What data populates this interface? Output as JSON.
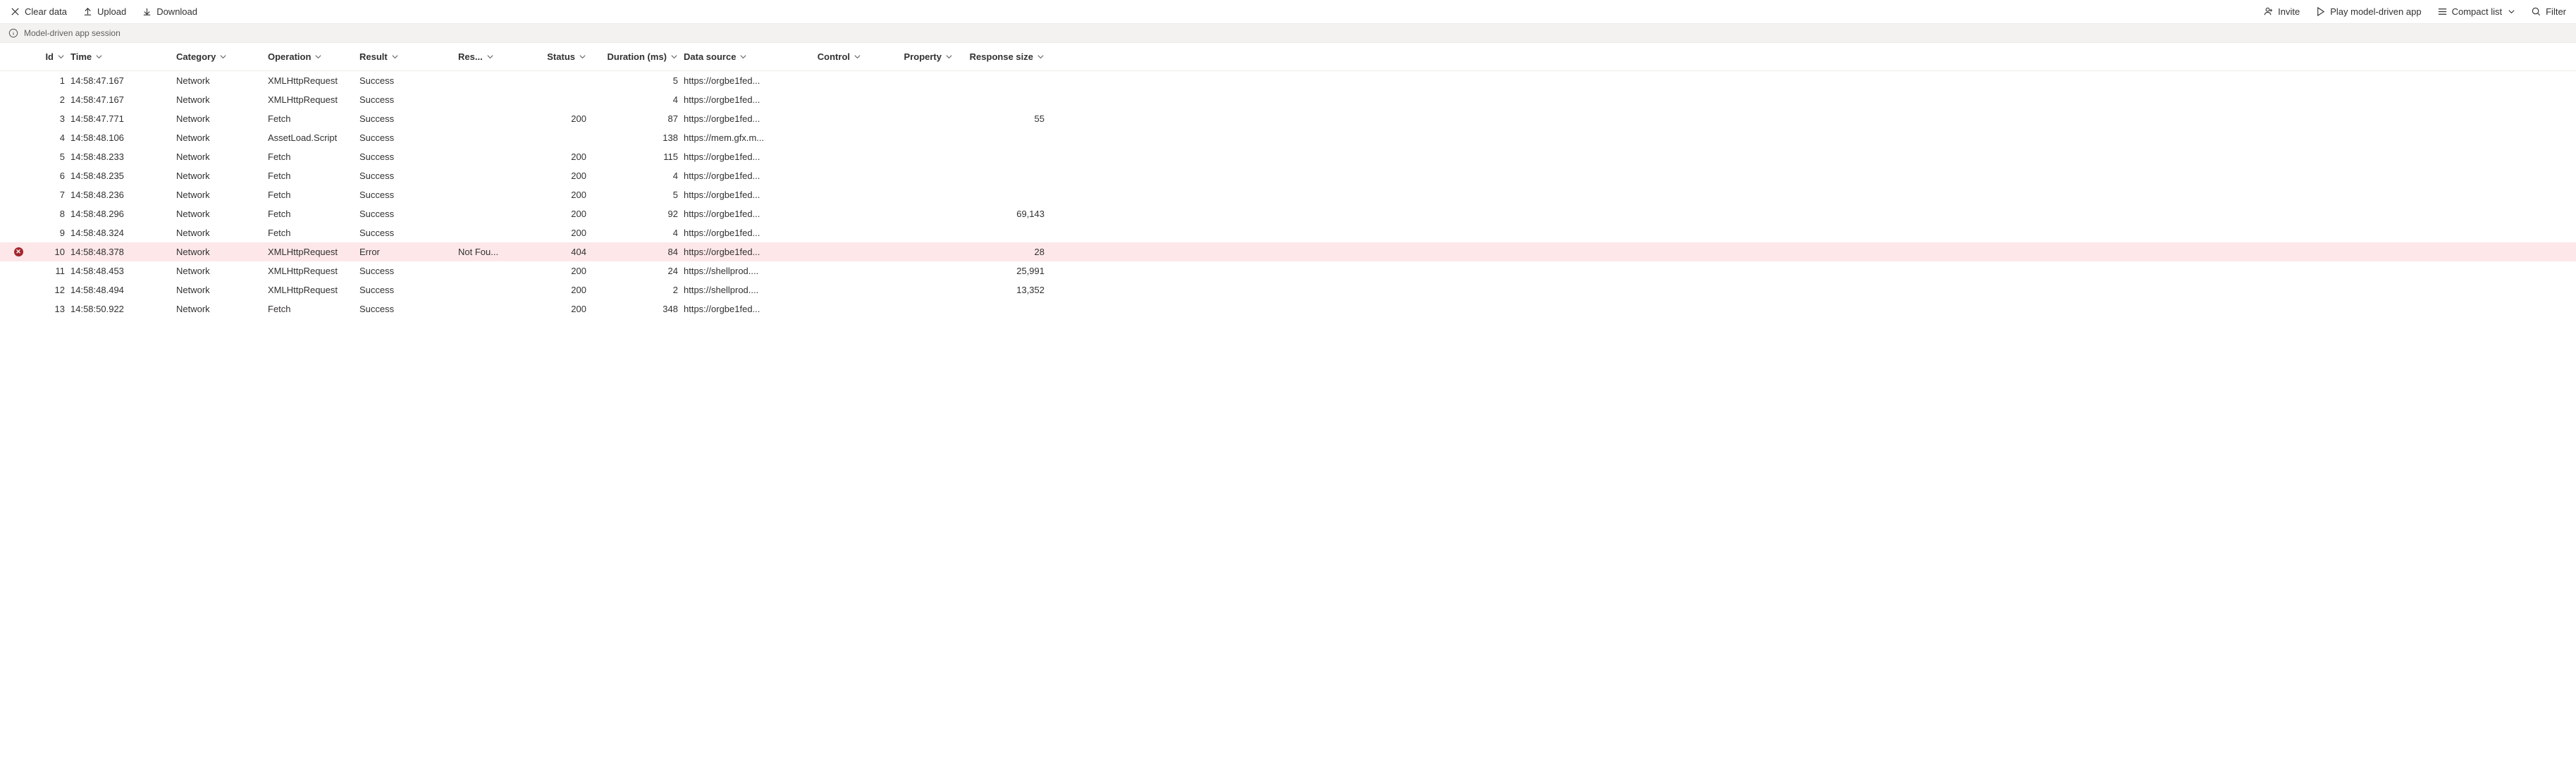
{
  "toolbar": {
    "clear_data": "Clear data",
    "upload": "Upload",
    "download": "Download",
    "invite": "Invite",
    "play_app": "Play model-driven app",
    "compact_list": "Compact list",
    "filter": "Filter"
  },
  "session_bar": {
    "label": "Model-driven app session"
  },
  "columns": {
    "id": "Id",
    "time": "Time",
    "category": "Category",
    "operation": "Operation",
    "result": "Result",
    "result_info": "Res...",
    "status": "Status",
    "duration": "Duration (ms)",
    "data_source": "Data source",
    "control": "Control",
    "property": "Property",
    "response_size": "Response size"
  },
  "rows": [
    {
      "id": "1",
      "time": "14:58:47.167",
      "category": "Network",
      "operation": "XMLHttpRequest",
      "result": "Success",
      "result_info": "",
      "status": "",
      "duration": "5",
      "data_source": "https://orgbe1fed...",
      "control": "",
      "property": "",
      "response_size": "",
      "error": false
    },
    {
      "id": "2",
      "time": "14:58:47.167",
      "category": "Network",
      "operation": "XMLHttpRequest",
      "result": "Success",
      "result_info": "",
      "status": "",
      "duration": "4",
      "data_source": "https://orgbe1fed...",
      "control": "",
      "property": "",
      "response_size": "",
      "error": false
    },
    {
      "id": "3",
      "time": "14:58:47.771",
      "category": "Network",
      "operation": "Fetch",
      "result": "Success",
      "result_info": "",
      "status": "200",
      "duration": "87",
      "data_source": "https://orgbe1fed...",
      "control": "",
      "property": "",
      "response_size": "55",
      "error": false
    },
    {
      "id": "4",
      "time": "14:58:48.106",
      "category": "Network",
      "operation": "AssetLoad.Script",
      "result": "Success",
      "result_info": "",
      "status": "",
      "duration": "138",
      "data_source": "https://mem.gfx.m...",
      "control": "",
      "property": "",
      "response_size": "",
      "error": false
    },
    {
      "id": "5",
      "time": "14:58:48.233",
      "category": "Network",
      "operation": "Fetch",
      "result": "Success",
      "result_info": "",
      "status": "200",
      "duration": "115",
      "data_source": "https://orgbe1fed...",
      "control": "",
      "property": "",
      "response_size": "",
      "error": false
    },
    {
      "id": "6",
      "time": "14:58:48.235",
      "category": "Network",
      "operation": "Fetch",
      "result": "Success",
      "result_info": "",
      "status": "200",
      "duration": "4",
      "data_source": "https://orgbe1fed...",
      "control": "",
      "property": "",
      "response_size": "",
      "error": false
    },
    {
      "id": "7",
      "time": "14:58:48.236",
      "category": "Network",
      "operation": "Fetch",
      "result": "Success",
      "result_info": "",
      "status": "200",
      "duration": "5",
      "data_source": "https://orgbe1fed...",
      "control": "",
      "property": "",
      "response_size": "",
      "error": false
    },
    {
      "id": "8",
      "time": "14:58:48.296",
      "category": "Network",
      "operation": "Fetch",
      "result": "Success",
      "result_info": "",
      "status": "200",
      "duration": "92",
      "data_source": "https://orgbe1fed...",
      "control": "",
      "property": "",
      "response_size": "69,143",
      "error": false
    },
    {
      "id": "9",
      "time": "14:58:48.324",
      "category": "Network",
      "operation": "Fetch",
      "result": "Success",
      "result_info": "",
      "status": "200",
      "duration": "4",
      "data_source": "https://orgbe1fed...",
      "control": "",
      "property": "",
      "response_size": "",
      "error": false
    },
    {
      "id": "10",
      "time": "14:58:48.378",
      "category": "Network",
      "operation": "XMLHttpRequest",
      "result": "Error",
      "result_info": "Not Fou...",
      "status": "404",
      "duration": "84",
      "data_source": "https://orgbe1fed...",
      "control": "",
      "property": "",
      "response_size": "28",
      "error": true
    },
    {
      "id": "11",
      "time": "14:58:48.453",
      "category": "Network",
      "operation": "XMLHttpRequest",
      "result": "Success",
      "result_info": "",
      "status": "200",
      "duration": "24",
      "data_source": "https://shellprod....",
      "control": "",
      "property": "",
      "response_size": "25,991",
      "error": false
    },
    {
      "id": "12",
      "time": "14:58:48.494",
      "category": "Network",
      "operation": "XMLHttpRequest",
      "result": "Success",
      "result_info": "",
      "status": "200",
      "duration": "2",
      "data_source": "https://shellprod....",
      "control": "",
      "property": "",
      "response_size": "13,352",
      "error": false
    },
    {
      "id": "13",
      "time": "14:58:50.922",
      "category": "Network",
      "operation": "Fetch",
      "result": "Success",
      "result_info": "",
      "status": "200",
      "duration": "348",
      "data_source": "https://orgbe1fed...",
      "control": "",
      "property": "",
      "response_size": "",
      "error": false
    }
  ]
}
